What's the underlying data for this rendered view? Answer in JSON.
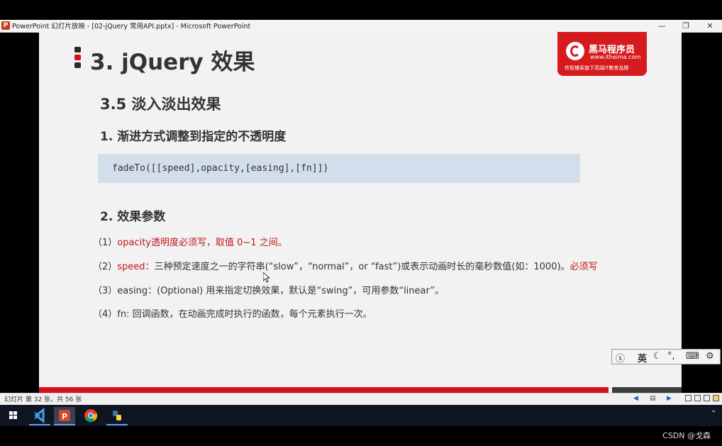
{
  "window": {
    "title": "PowerPoint 幻灯片放映 - [02-jQuery 常用API.pptx] - Microsoft PowerPoint",
    "minimize": "—",
    "restore": "❐",
    "close": "✕"
  },
  "slide": {
    "title": "3. jQuery 效果",
    "logo": {
      "name": "黑马程序员",
      "url": "www.itheima.com",
      "slogan": "传智播客旗下高端IT教育品牌"
    },
    "section": "3.5  淡入淡出效果",
    "subheading1": "1. 渐进方式调整到指定的不透明度",
    "code": "fadeTo([[speed],opacity,[easing],[fn]])",
    "subheading2": "2. 效果参数",
    "params": [
      {
        "prefix": "（1）",
        "highlight": "opacity透明度必须写，取值 0~1 之间。",
        "text": "",
        "suffix": ""
      },
      {
        "prefix": "（2）",
        "highlight": "speed：",
        "text": "三种预定速度之一的字符串(“slow”，“normal”，or “fast”)或表示动画时长的毫秒数值(如：1000)。",
        "suffix": "必须写"
      },
      {
        "prefix": "（3）",
        "highlight": "",
        "text": "easing：(Optional) 用来指定切换效果，默认是“swing”，可用参数“linear”。",
        "suffix": ""
      },
      {
        "prefix": "（4）",
        "highlight": "",
        "text": "fn:  回调函数，在动画完成时执行的函数，每个元素执行一次。",
        "suffix": ""
      }
    ]
  },
  "ime": {
    "mode": "英",
    "moon": "☾",
    "punct": "°,",
    "keyboard": "⌨",
    "settings": "⚙"
  },
  "statusbar": {
    "slide_info": "幻灯片 第 32 张，共 56 张"
  },
  "taskbar": {
    "items": [
      "start",
      "vscode",
      "powerpoint",
      "chrome",
      "python"
    ]
  },
  "watermark": "CSDN @戈森",
  "colors": {
    "accent_red": "#d7131a",
    "code_bg": "#d3deec",
    "highlight_text": "#c0161c"
  }
}
